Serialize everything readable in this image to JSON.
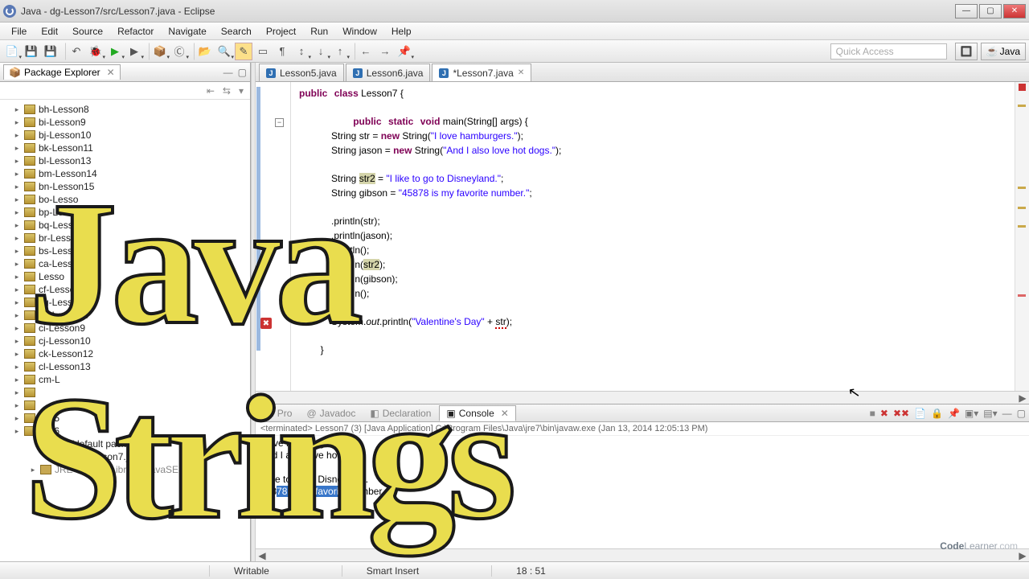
{
  "window": {
    "title": "Java - dg-Lesson7/src/Lesson7.java - Eclipse"
  },
  "menu": [
    "File",
    "Edit",
    "Source",
    "Refactor",
    "Navigate",
    "Search",
    "Project",
    "Run",
    "Window",
    "Help"
  ],
  "quick_access_placeholder": "Quick Access",
  "perspective_label": "Java",
  "package_explorer": {
    "title": "Package Explorer",
    "items": [
      "bh-Lesson8",
      "bi-Lesson9",
      "bj-Lesson10",
      "bk-Lesson11",
      "bl-Lesson13",
      "bm-Lesson14",
      "bn-Lesson15",
      "bo-Lesso",
      "bp-Lesso",
      "bq-Lesso",
      "br-Lesso",
      "bs-Lesso",
      "ca-Lesso",
      "    Lesso",
      "cf-Lesson6",
      "cg-Lesson7",
      "ch-Lesson8",
      "ci-Lesson9",
      "cj-Lesson10",
      "ck-Lesson12",
      "cl-Lesson13",
      "cm-L",
      "",
      "",
      "son5",
      "son6"
    ],
    "expanded_pkg": "(default package)",
    "expanded_file": "Lesson7.java",
    "jre": "JRE System Library [JavaSE-1.7]"
  },
  "editor_tabs": [
    {
      "label": "Lesson5.java",
      "active": false
    },
    {
      "label": "Lesson6.java",
      "active": false
    },
    {
      "label": "*Lesson7.java",
      "active": true
    }
  ],
  "code": {
    "l1a": "public",
    "l1b": "class",
    "l1c": " Lesson7 {",
    "l2a": "public",
    "l2b": "static",
    "l2c": "void",
    "l2d": " main(String[] args) {",
    "l3a": "            String str = ",
    "l3b": "new",
    "l3c": " String(",
    "l3d": "\"I love hamburgers.\"",
    "l3e": ");",
    "l4a": "            String jason = ",
    "l4b": "new",
    "l4c": " String(",
    "l4d": "\"And I also love hot dogs.\"",
    "l4e": ");",
    "l5a": "            String ",
    "l5b": "str2",
    "l5c": " = ",
    "l5d": "\"I like to go to Disneyland.\"",
    "l5e": ";",
    "l6a": "            String gibson = ",
    "l6b": "\"45878 is my favorite number.\"",
    "l6c": ";",
    "p1": "            .println(str);",
    "p2": "            .println(jason);",
    "p3": "            .println();",
    "p4a": "            .println(",
    "p4b": "str2",
    "p4c": ");",
    "p5": "             println(gibson);",
    "p6": "             println();",
    "l7a": "            System.",
    "l7b": "out",
    "l7c": ".println(",
    "l7d": "\"Valentine's Day\"",
    "l7e": " + ",
    "l7f": "str",
    "l7g": ");",
    "l8": "        }"
  },
  "bottom_tabs": [
    "Pro",
    "Javadoc",
    "Declaration",
    "Console"
  ],
  "console": {
    "header": "<terminated> Lesson7 (3) [Java Application] C:\\Program Files\\Java\\jre7\\bin\\javaw.exe (Jan 13, 2014 12:05:13 PM)",
    "l1": "I love hamburgers.",
    "l2": "And I also love hot dogs.",
    "l3": "",
    "l4": "I like to go to Disneyland.",
    "l5a": "458",
    "l5b": "78 is my favorite nu",
    "l5c": "mber."
  },
  "status": {
    "writable": "Writable",
    "insert": "Smart Insert",
    "pos": "18 : 51"
  },
  "overlay": {
    "word1": "Java",
    "word2": "Strings"
  },
  "watermark": {
    "a": "Code",
    "b": "Learner",
    "c": ".com"
  }
}
